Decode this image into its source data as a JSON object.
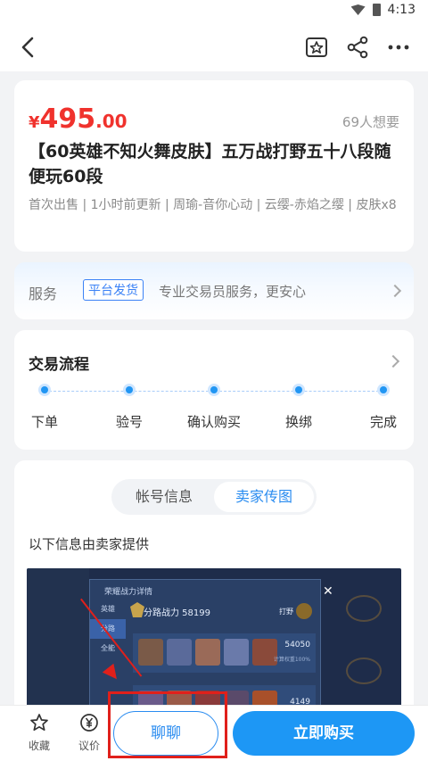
{
  "status": {
    "time": "4:13"
  },
  "listing": {
    "currency": "¥",
    "price_int": "495",
    "price_dec": ".00",
    "want_count": "69人想要",
    "title": "【60英雄不知火舞皮肤】五万战打野五十八段随便玩60段",
    "tags": "首次出售 | 1小时前更新 | 周瑜-音你心动 | 云缨-赤焰之缨 | 皮肤x8"
  },
  "service": {
    "label": "服务",
    "badge": "平台发货",
    "desc": "专业交易员服务，更安心"
  },
  "flow": {
    "title": "交易流程",
    "steps": [
      "下单",
      "验号",
      "确认购买",
      "换绑",
      "完成"
    ]
  },
  "info": {
    "tabs": [
      "帐号信息",
      "卖家传图"
    ],
    "active_tab": "卖家传图",
    "provided_by": "以下信息由卖家提供",
    "screenshot": {
      "panel_title": "荣耀战力详情",
      "menu": [
        "英雄",
        "分路",
        "全能"
      ],
      "score": "分路战力 58199",
      "role": "打野",
      "row1_value": "54050",
      "row1_sub": "计算权重100%",
      "row2_value": "4149"
    }
  },
  "bottom": {
    "favorite": "收藏",
    "bargain": "议价",
    "chat": "聊聊",
    "buy": "立即购买"
  },
  "colors": {
    "price": "#f0322d",
    "accent": "#2a8cf0",
    "buy_button": "#1d97f5",
    "annotation_red": "#e0201b"
  }
}
